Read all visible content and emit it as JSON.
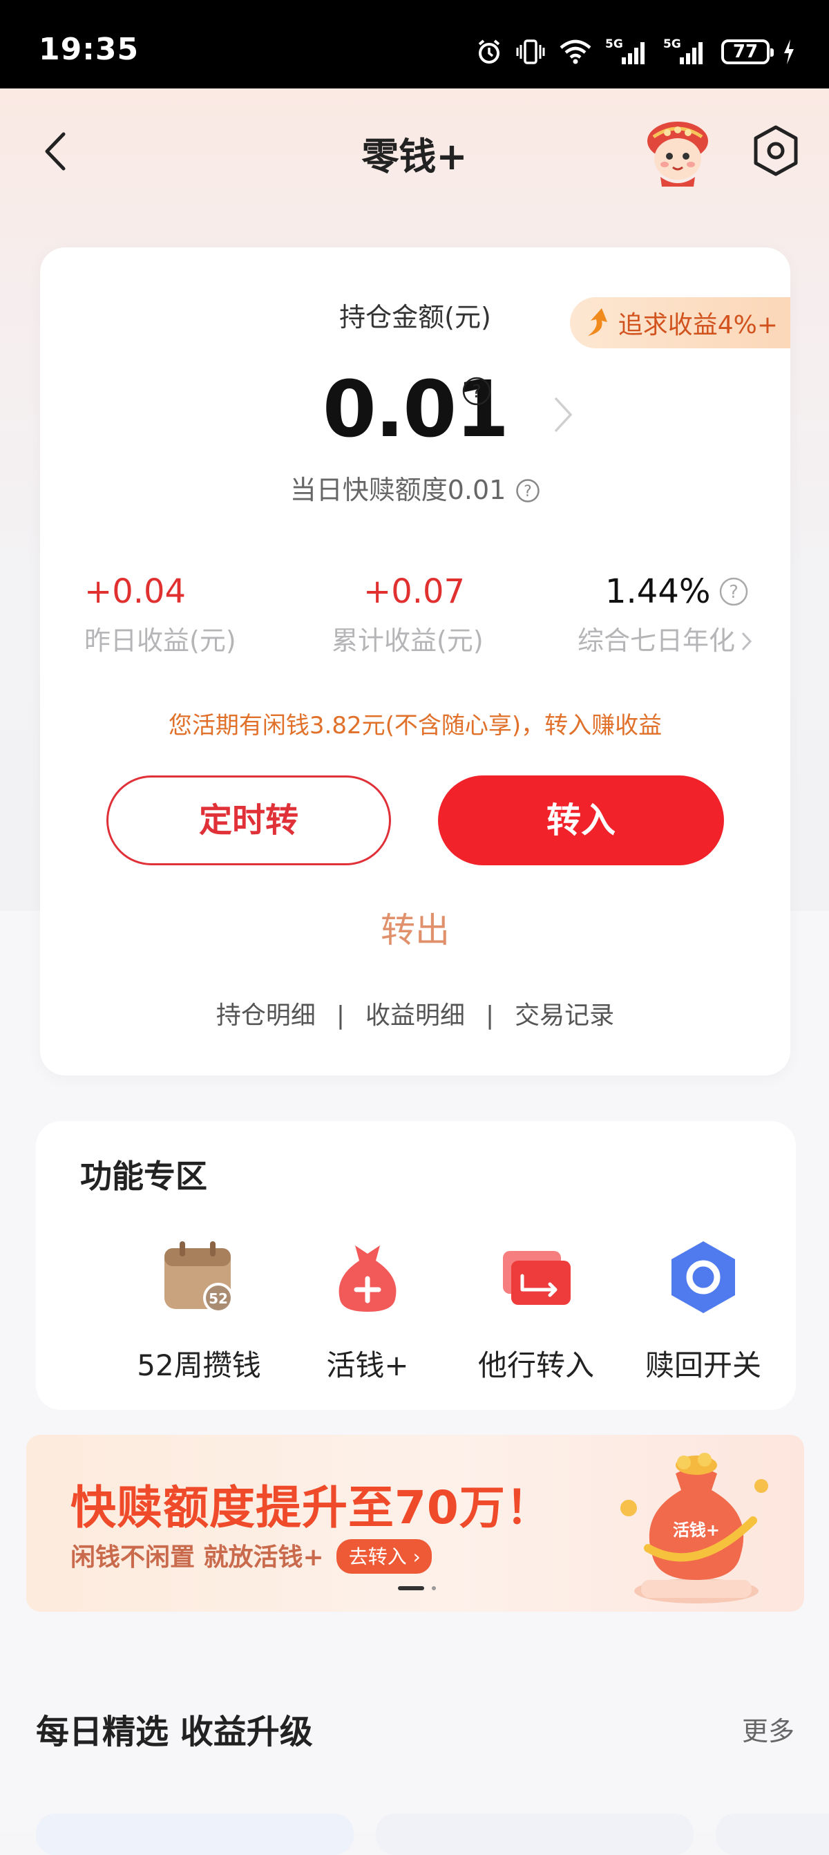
{
  "status_bar": {
    "time": "19:35",
    "battery": "77",
    "icons": [
      "alarm-icon",
      "vibrate-icon",
      "wifi-icon",
      "signal-5g-icon",
      "signal-5g-icon",
      "battery-icon",
      "charging-icon"
    ]
  },
  "nav": {
    "title": "零钱+"
  },
  "card": {
    "holding_label": "持仓金额(元)",
    "chase_badge": "追求收益4%+",
    "amount": "0.01",
    "quick_limit": "当日快赎额度0.01",
    "stats": [
      {
        "value": "+0.04",
        "label": "昨日收益(元)"
      },
      {
        "value": "+0.07",
        "label": "累计收益(元)"
      },
      {
        "value": "1.44%",
        "label": "综合七日年化"
      }
    ],
    "idle_tip": "您活期有闲钱3.82元(不含随心享)，转入赚收益",
    "timer_button": "定时转",
    "in_button": "转入",
    "out_button": "转出",
    "links": [
      "持仓明细",
      "收益明细",
      "交易记录"
    ],
    "separator": "|"
  },
  "functions": {
    "title": "功能专区",
    "items": [
      {
        "label": "52周攒钱",
        "icon": "calendar-52-icon",
        "badge": "52"
      },
      {
        "label": "活钱+",
        "icon": "money-bag-plus-icon"
      },
      {
        "label": "他行转入",
        "icon": "transfer-card-icon"
      },
      {
        "label": "赎回开关",
        "icon": "hexagon-toggle-icon"
      }
    ]
  },
  "banner": {
    "title": "快赎额度提升至70万！",
    "subtitle": "闲钱不闲置 就放活钱+",
    "button": "去转入",
    "art_label": "活钱+"
  },
  "daily": {
    "title": "每日精选 收益升级",
    "more": "更多"
  },
  "colors": {
    "accent_red": "#f2222b",
    "gain_red": "#e03030",
    "tip_orange": "#e0702a",
    "out_orange": "#e0906a"
  }
}
